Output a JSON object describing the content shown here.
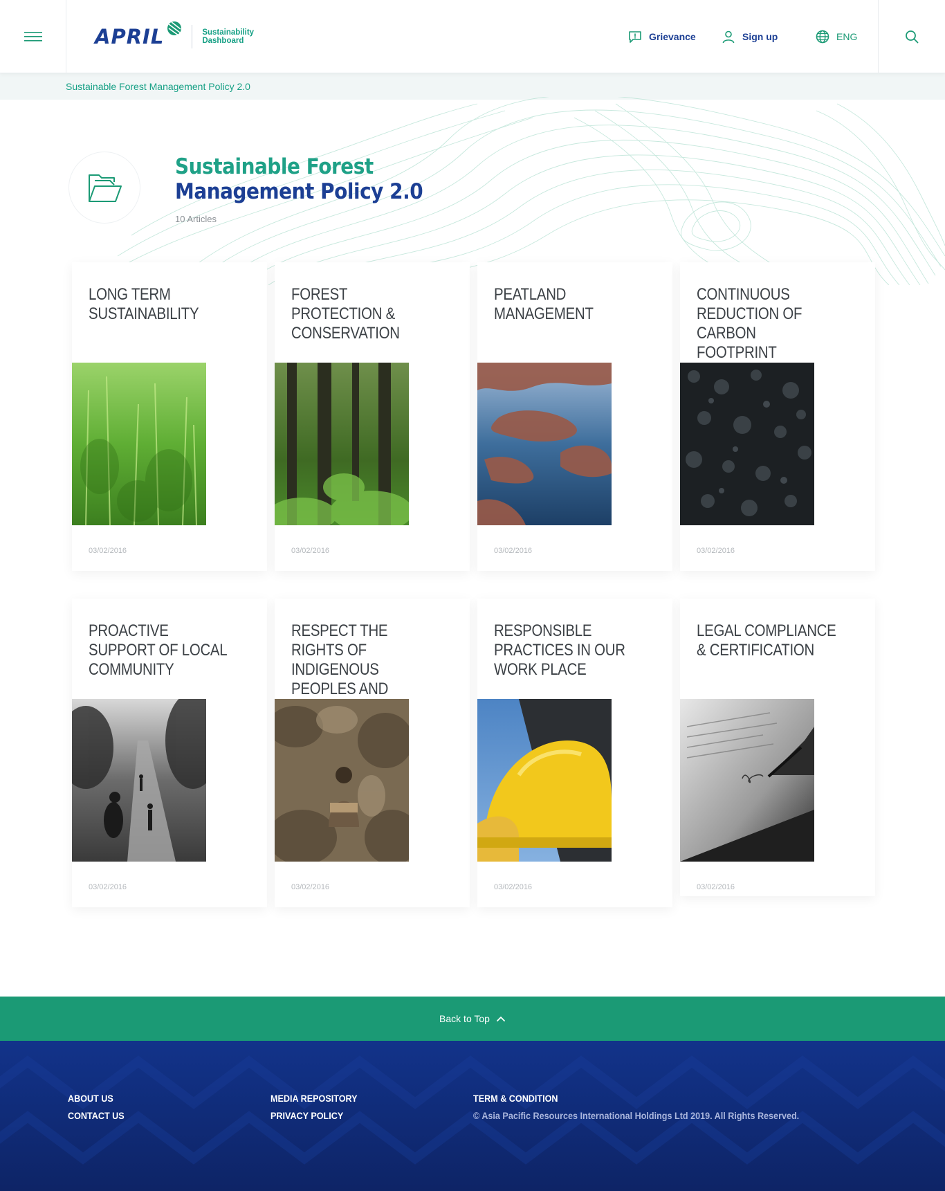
{
  "header": {
    "logo_text": "APRIL",
    "logo_sub1": "Sustainability",
    "logo_sub2": "Dashboard",
    "grievance_label": "Grievance",
    "signup_label": "Sign up",
    "language_label": "ENG"
  },
  "breadcrumb": {
    "current": "Sustainable Forest Management Policy 2.0"
  },
  "page": {
    "title_line1": "Sustainable Forest",
    "title_line2": "Management Policy 2.0",
    "article_count": "10 Articles"
  },
  "cards": [
    {
      "title": "Long Term Sustainability",
      "date": "03/02/2016",
      "image": "green-plants"
    },
    {
      "title": "Forest Protection & Conservation",
      "date": "03/02/2016",
      "image": "forest"
    },
    {
      "title": "Peatland Management",
      "date": "03/02/2016",
      "image": "peatland"
    },
    {
      "title": "Continuous Reduction of Carbon Footprint",
      "date": "03/02/2016",
      "image": "coal"
    },
    {
      "title": "Proactive Support of Local Community",
      "date": "03/02/2016",
      "image": "villagers-path"
    },
    {
      "title": "Respect the Rights of Indigenous Peoples and Communities",
      "date": "03/02/2016",
      "image": "indigenous-woman"
    },
    {
      "title": "Responsible Practices in Our Work Place",
      "date": "03/02/2016",
      "image": "hard-hat"
    },
    {
      "title": "Legal Compliance & Certification",
      "date": "03/02/2016",
      "image": "signature"
    }
  ],
  "back_to_top": "Back to Top",
  "footer": {
    "col1": [
      "ABOUT US",
      "CONTACT US"
    ],
    "col2": [
      "MEDIA REPOSITORY",
      "PRIVACY POLICY"
    ],
    "col3_link": "TERM & CONDITION",
    "copyright": "© Asia Pacific Resources International Holdings Ltd 2019. All Rights Reserved."
  },
  "colors": {
    "brand_blue": "#1c3f94",
    "brand_green": "#1fa187",
    "back_to_top_bg": "#1b9a75",
    "footer_bg": "#12338a"
  }
}
